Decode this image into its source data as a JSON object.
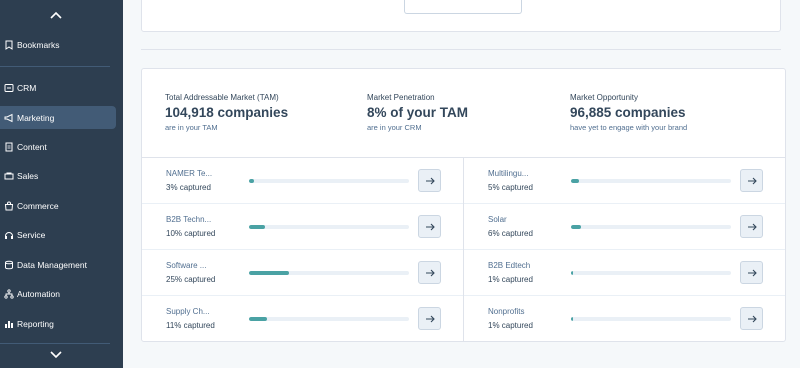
{
  "sidebar": {
    "items": [
      {
        "label": "Bookmarks",
        "icon": "bookmark-icon"
      },
      {
        "label": "CRM",
        "icon": "crm-icon"
      },
      {
        "label": "Marketing",
        "icon": "megaphone-icon",
        "active": true
      },
      {
        "label": "Content",
        "icon": "document-icon"
      },
      {
        "label": "Sales",
        "icon": "sales-icon"
      },
      {
        "label": "Commerce",
        "icon": "shopping-bag-icon"
      },
      {
        "label": "Service",
        "icon": "service-icon"
      },
      {
        "label": "Data Management",
        "icon": "database-icon"
      },
      {
        "label": "Automation",
        "icon": "automation-icon"
      },
      {
        "label": "Reporting",
        "icon": "bar-chart-icon"
      }
    ]
  },
  "stats": [
    {
      "label": "Total Addressable Market (TAM)",
      "value": "104,918 companies",
      "sub": "are in your TAM"
    },
    {
      "label": "Market Penetration",
      "value": "8% of your TAM",
      "sub": "are in your CRM"
    },
    {
      "label": "Market Opportunity",
      "value": "96,885 companies",
      "sub": "have yet to engage with your brand"
    }
  ],
  "segments_left": [
    {
      "name": "NAMER Te...",
      "captured": "3% captured",
      "fraction": 0.03
    },
    {
      "name": "B2B Techn...",
      "captured": "10% captured",
      "fraction": 0.1
    },
    {
      "name": "Software ...",
      "captured": "25% captured",
      "fraction": 0.25
    },
    {
      "name": "Supply Ch...",
      "captured": "11% captured",
      "fraction": 0.11
    }
  ],
  "segments_right": [
    {
      "name": "Multilingu...",
      "captured": "5% captured",
      "fraction": 0.05
    },
    {
      "name": "Solar",
      "captured": "6% captured",
      "fraction": 0.06
    },
    {
      "name": "B2B Edtech",
      "captured": "1% captured",
      "fraction": 0.01
    },
    {
      "name": "Nonprofits",
      "captured": "1% captured",
      "fraction": 0.01
    }
  ],
  "colors": {
    "sidebar_bg": "#2d3e50",
    "sidebar_active": "#425b76",
    "progress_fill": "#4aa2a4",
    "progress_track": "#eaf0f6"
  }
}
